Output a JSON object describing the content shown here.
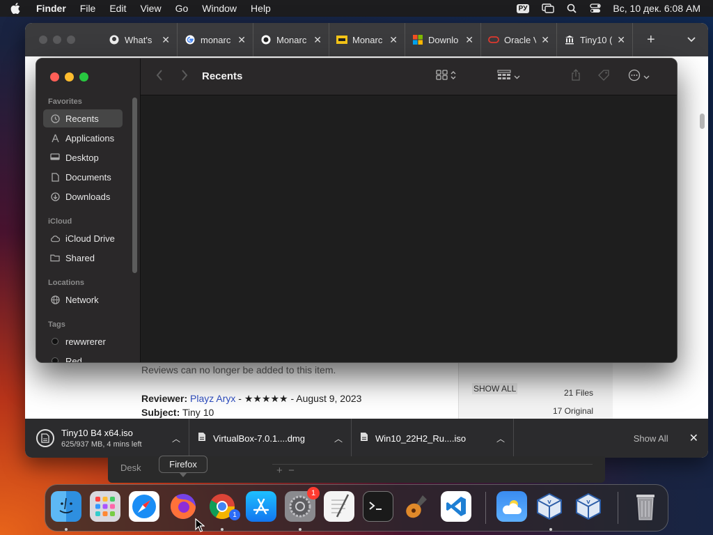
{
  "menubar": {
    "app": "Finder",
    "items": [
      "File",
      "Edit",
      "View",
      "Go",
      "Window",
      "Help"
    ],
    "input_source": "РУ",
    "clock": "Вс, 10 дек.  6:08 AM"
  },
  "browser": {
    "tabs": [
      {
        "title": "What's",
        "icon": "github-icon"
      },
      {
        "title": "monarc",
        "icon": "google-icon"
      },
      {
        "title": "Monarc",
        "icon": "github-dark-icon"
      },
      {
        "title": "Monarc",
        "icon": "yellow-square-icon"
      },
      {
        "title": "Downlo",
        "icon": "microsoft-icon"
      },
      {
        "title": "Oracle V",
        "icon": "oracle-icon"
      },
      {
        "title": "Tiny10 (",
        "icon": "archive-icon"
      }
    ],
    "page": {
      "notice": "Reviews can no longer be added to this item.",
      "reviewer_label": "Reviewer:",
      "reviewer_name": "Playz Aryx",
      "reviewer_rest": " - ★★★★★ - August 9, 2023",
      "subject_label": "Subject:",
      "subject_value": " Tiny 10",
      "show_all": "SHOW ALL",
      "files_count": "21 Files",
      "original_count": "17 Original"
    },
    "downloads": [
      {
        "name": "Tiny10 B4 x64.iso",
        "status": "625/937 MB, 4 mins left",
        "progress": 0.667
      },
      {
        "name": "VirtualBox-7.0.1....dmg"
      },
      {
        "name": "Win10_22H2_Ru....iso"
      }
    ],
    "downloads_show_all": "Show All"
  },
  "finder": {
    "title": "Recents",
    "sidebar": {
      "favorites_header": "Favorites",
      "favorites": [
        {
          "label": "Recents",
          "icon": "clock-icon",
          "active": true
        },
        {
          "label": "Applications",
          "icon": "applications-icon"
        },
        {
          "label": "Desktop",
          "icon": "desktop-icon"
        },
        {
          "label": "Documents",
          "icon": "document-icon"
        },
        {
          "label": "Downloads",
          "icon": "download-icon"
        }
      ],
      "icloud_header": "iCloud",
      "icloud": [
        {
          "label": "iCloud Drive",
          "icon": "cloud-icon"
        },
        {
          "label": "Shared",
          "icon": "shared-folder-icon"
        }
      ],
      "locations_header": "Locations",
      "locations": [
        {
          "label": "Network",
          "icon": "globe-icon"
        }
      ],
      "tags_header": "Tags",
      "tags": [
        {
          "label": "rewwrerer"
        },
        {
          "label": "Red"
        }
      ]
    }
  },
  "back_window": {
    "label": "Desk"
  },
  "tooltip": "Firefox",
  "dock": {
    "apps": [
      "Finder",
      "Launchpad",
      "Safari",
      "Firefox",
      "Google Chrome",
      "App Store",
      "System Settings",
      "TextEdit",
      "Terminal",
      "GarageBand",
      "Visual Studio Code",
      "Weather",
      "VirtualBox",
      "VirtualBox VM",
      "Trash"
    ],
    "settings_badge": "1",
    "chrome_badge": "1"
  }
}
